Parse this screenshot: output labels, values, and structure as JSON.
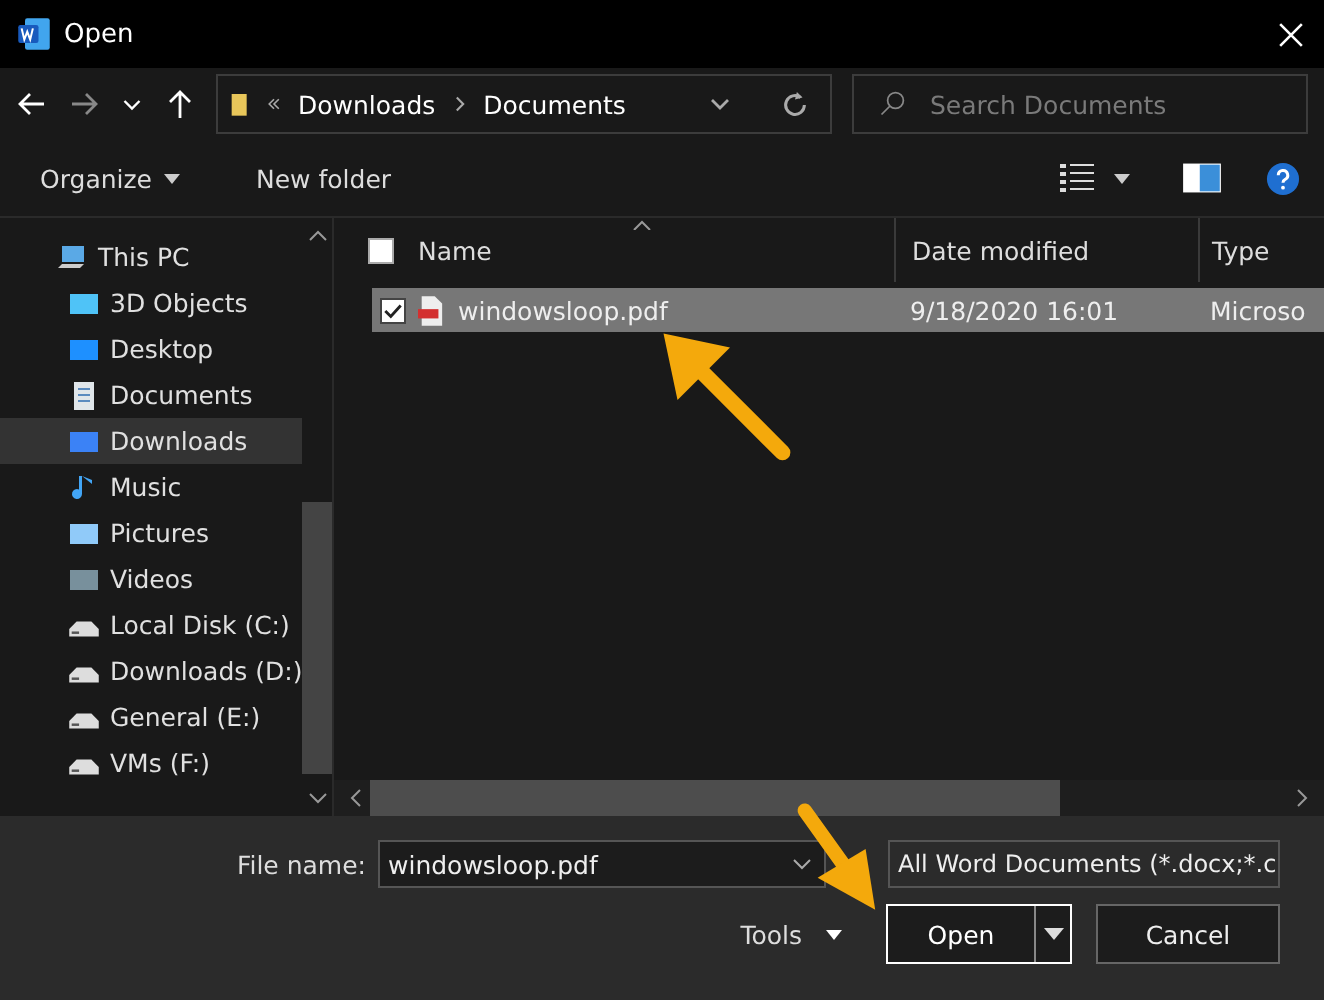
{
  "window": {
    "title": "Open"
  },
  "nav": {
    "path": [
      "Downloads",
      "Documents"
    ],
    "search": {
      "placeholder": "Search Documents"
    }
  },
  "toolbar": {
    "organize": "Organize",
    "new_folder": "New folder"
  },
  "sidebar": {
    "items": [
      {
        "label": "This PC",
        "kind": "pc",
        "selected": false,
        "children": [
          {
            "label": "3D Objects",
            "kind": "objects",
            "selected": false
          },
          {
            "label": "Desktop",
            "kind": "desktop",
            "selected": false
          },
          {
            "label": "Documents",
            "kind": "documents",
            "selected": false
          },
          {
            "label": "Downloads",
            "kind": "downloads",
            "selected": true
          },
          {
            "label": "Music",
            "kind": "music",
            "selected": false
          },
          {
            "label": "Pictures",
            "kind": "pictures",
            "selected": false
          },
          {
            "label": "Videos",
            "kind": "videos",
            "selected": false
          },
          {
            "label": "Local Disk (C:)",
            "kind": "drive",
            "selected": false
          },
          {
            "label": "Downloads (D:)",
            "kind": "drive",
            "selected": false
          },
          {
            "label": "General (E:)",
            "kind": "drive",
            "selected": false
          },
          {
            "label": "VMs (F:)",
            "kind": "drive",
            "selected": false
          }
        ]
      }
    ]
  },
  "table": {
    "columns": [
      "Name",
      "Date modified",
      "Type"
    ],
    "select_all_checked": false,
    "rows": [
      {
        "name": "windowsloop.pdf",
        "date": "9/18/2020 16:01",
        "type": "Microso",
        "selected": true,
        "checked": true
      }
    ]
  },
  "footer": {
    "file_name_label": "File name:",
    "file_name": "windowsloop.pdf",
    "filter": "All Word Documents (*.docx;*.c",
    "tools": "Tools",
    "open": "Open",
    "cancel": "Cancel"
  }
}
